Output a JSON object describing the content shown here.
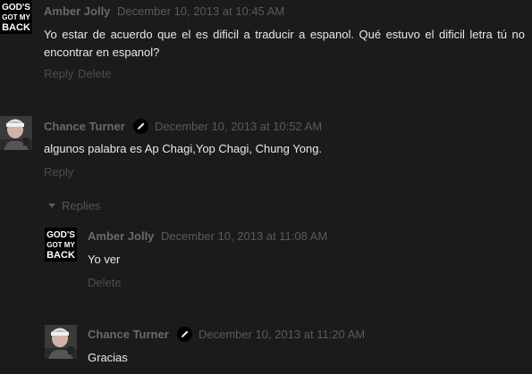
{
  "comments": [
    {
      "author": "Amber Jolly",
      "timestamp": "December 10, 2013 at 10:45 AM",
      "avatar_icon": "gods-got-my-back-logo",
      "avatar_lines": [
        "GOD'S",
        "GOT MY",
        "BACK"
      ],
      "body": "Yo estar de acuerdo que el es dificil a traducir a espanol. Qué estuvo el dificil letra tú no encontrar en espanol?",
      "actions": {
        "reply": "Reply",
        "delete": "Delete"
      }
    },
    {
      "author": "Chance Turner",
      "timestamp": "December 10, 2013 at 10:52 AM",
      "avatar_icon": "user-photo",
      "body": "algunos palabra es Ap Chagi,Yop Chagi, Chung Yong.",
      "actions": {
        "reply": "Reply"
      }
    }
  ],
  "replies_label": "Replies",
  "replies": [
    {
      "author": "Amber Jolly",
      "timestamp": "December 10, 2013 at 11:08 AM",
      "avatar_icon": "gods-got-my-back-logo",
      "avatar_lines": [
        "GOD'S",
        "GOT MY",
        "BACK"
      ],
      "body": "Yo ver",
      "actions": {
        "delete": "Delete"
      }
    },
    {
      "author": "Chance Turner",
      "timestamp": "December 10, 2013 at 11:20 AM",
      "avatar_icon": "user-photo",
      "body": "Gracias"
    }
  ],
  "colors": {
    "background": "#1b1b1b",
    "author": "#6a6a6a",
    "timestamp": "#5a5a5a",
    "body_text": "#e8e8e8",
    "action_link": "#4d4d4d"
  }
}
